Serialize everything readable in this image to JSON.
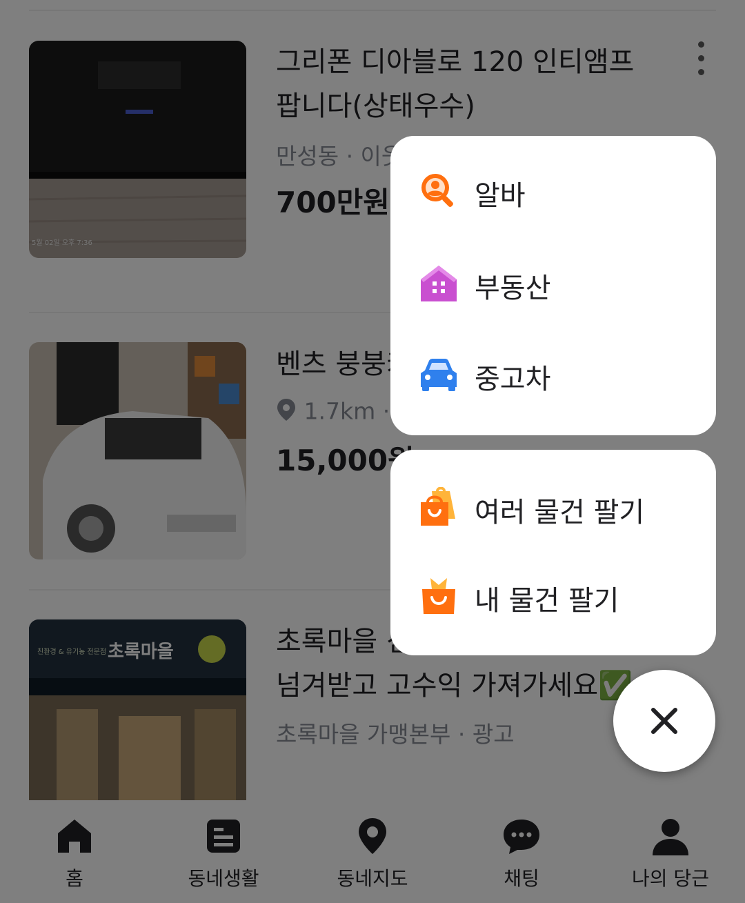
{
  "feed": {
    "items": [
      {
        "title_line1": "그리폰 디아블로 120 인티앰프",
        "title_line2": "팝니다(상태우수)",
        "meta": "만성동 · 이웃",
        "price": "700만원",
        "thumb_caption": "5월 02일 오후 7:36"
      },
      {
        "title_line1": "벤츠 붕붕카",
        "distance": "1.7km",
        "meta_sep": "·",
        "price": "15,000원"
      },
      {
        "title_line1": "초록마을 신",
        "title_line2": "넘겨받고 고수익 가져가세요✅",
        "meta": "초록마을 가맹본부 · 광고",
        "sign_text": "초록마을",
        "sign_small": "친환경 & 유기농 전문점"
      }
    ]
  },
  "menu": {
    "group1": [
      {
        "label": "알바",
        "icon": "job-search-icon"
      },
      {
        "label": "부동산",
        "icon": "house-icon"
      },
      {
        "label": "중고차",
        "icon": "car-icon"
      }
    ],
    "group2": [
      {
        "label": "여러 물건 팔기",
        "icon": "multi-bag-icon"
      },
      {
        "label": "내 물건 팔기",
        "icon": "bag-icon"
      }
    ]
  },
  "fab": {
    "icon": "close-icon"
  },
  "tabs": [
    {
      "label": "홈",
      "icon": "home-icon",
      "active": true
    },
    {
      "label": "동네생활",
      "icon": "board-icon"
    },
    {
      "label": "동네지도",
      "icon": "map-pin-icon"
    },
    {
      "label": "채팅",
      "icon": "chat-icon"
    },
    {
      "label": "나의 당근",
      "icon": "profile-icon"
    }
  ],
  "colors": {
    "orange": "#ff6f0f",
    "purple": "#c94fd0",
    "blue": "#2f80ed",
    "text": "#212124",
    "muted": "#868b94"
  }
}
